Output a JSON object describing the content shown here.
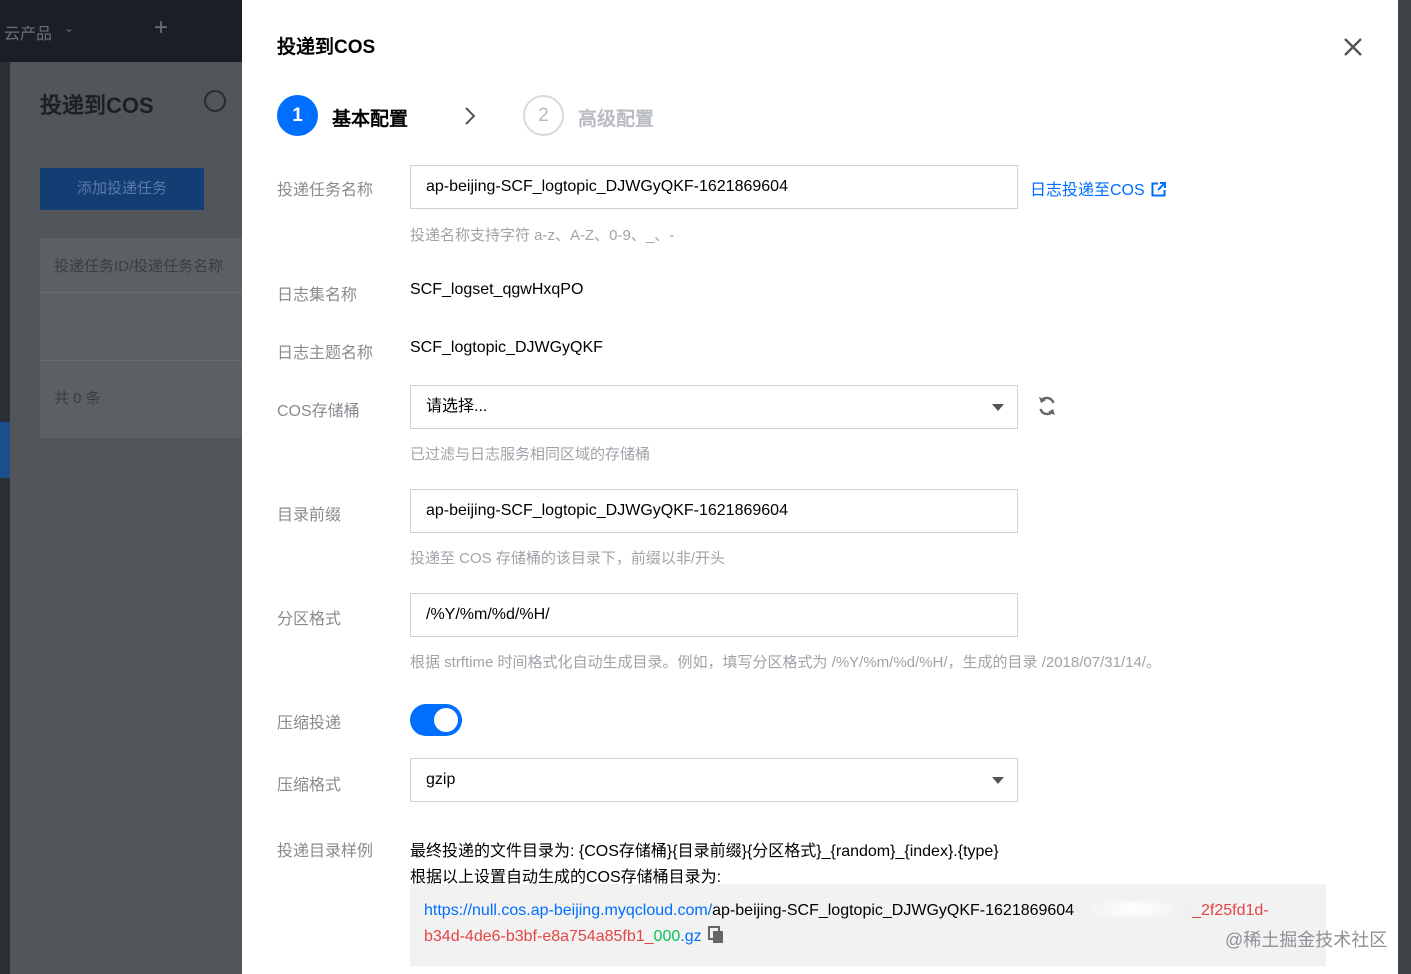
{
  "background": {
    "topbar_product": "云产品",
    "page_title": "投递到COS",
    "add_button": "添加投递任务",
    "table_header": "投递任务ID/投递任务名称",
    "table_count": "共 0 条"
  },
  "modal": {
    "title": "投递到COS",
    "steps": [
      {
        "number": "1",
        "label": "基本配置",
        "active": true
      },
      {
        "number": "2",
        "label": "高级配置",
        "active": false
      }
    ],
    "fields": {
      "task_name": {
        "label": "投递任务名称",
        "value": "ap-beijing-SCF_logtopic_DJWGyQKF-1621869604",
        "help": "投递名称支持字符 a-z、A-Z、0-9、_、-",
        "link": "日志投递至COS"
      },
      "logset": {
        "label": "日志集名称",
        "value": "SCF_logset_qgwHxqPO"
      },
      "logtopic": {
        "label": "日志主题名称",
        "value": "SCF_logtopic_DJWGyQKF"
      },
      "bucket": {
        "label": "COS存储桶",
        "value": "请选择...",
        "help": "已过滤与日志服务相同区域的存储桶"
      },
      "prefix": {
        "label": "目录前缀",
        "value": "ap-beijing-SCF_logtopic_DJWGyQKF-1621869604",
        "help": "投递至 COS 存储桶的该目录下，前缀以非/开头"
      },
      "partition": {
        "label": "分区格式",
        "value": "/%Y/%m/%d/%H/",
        "help": "根据 strftime 时间格式化自动生成目录。例如，填写分区格式为 /%Y/%m/%d/%H/，生成的目录 /2018/07/31/14/。"
      },
      "compress": {
        "label": "压缩投递",
        "enabled": true
      },
      "compress_format": {
        "label": "压缩格式",
        "value": "gzip"
      },
      "example": {
        "label": "投递目录样例",
        "line1": "最终投递的文件目录为: {COS存储桶}{目录前缀}{分区格式}_{random}_{index}.{type}",
        "line2": "根据以上设置自动生成的COS存储桶目录为:",
        "url_part": "https://null.cos.ap-beijing.myqcloud.com/",
        "prefix_part": "ap-beijing-SCF_logtopic_DJWGyQKF-1621869604",
        "uuid_part1": "_2f25fd1d-",
        "uuid_part2": "b34d-4de6-b3bf-e8a754a85fb1_",
        "index_part": "000",
        "ext_part": ".gz"
      }
    }
  },
  "watermark": "@稀土掘金技术社区",
  "colors": {
    "primary": "#006eff",
    "label": "#888b90",
    "help": "#a0a3a8",
    "red": "#e54545",
    "green": "#0abf5b"
  }
}
